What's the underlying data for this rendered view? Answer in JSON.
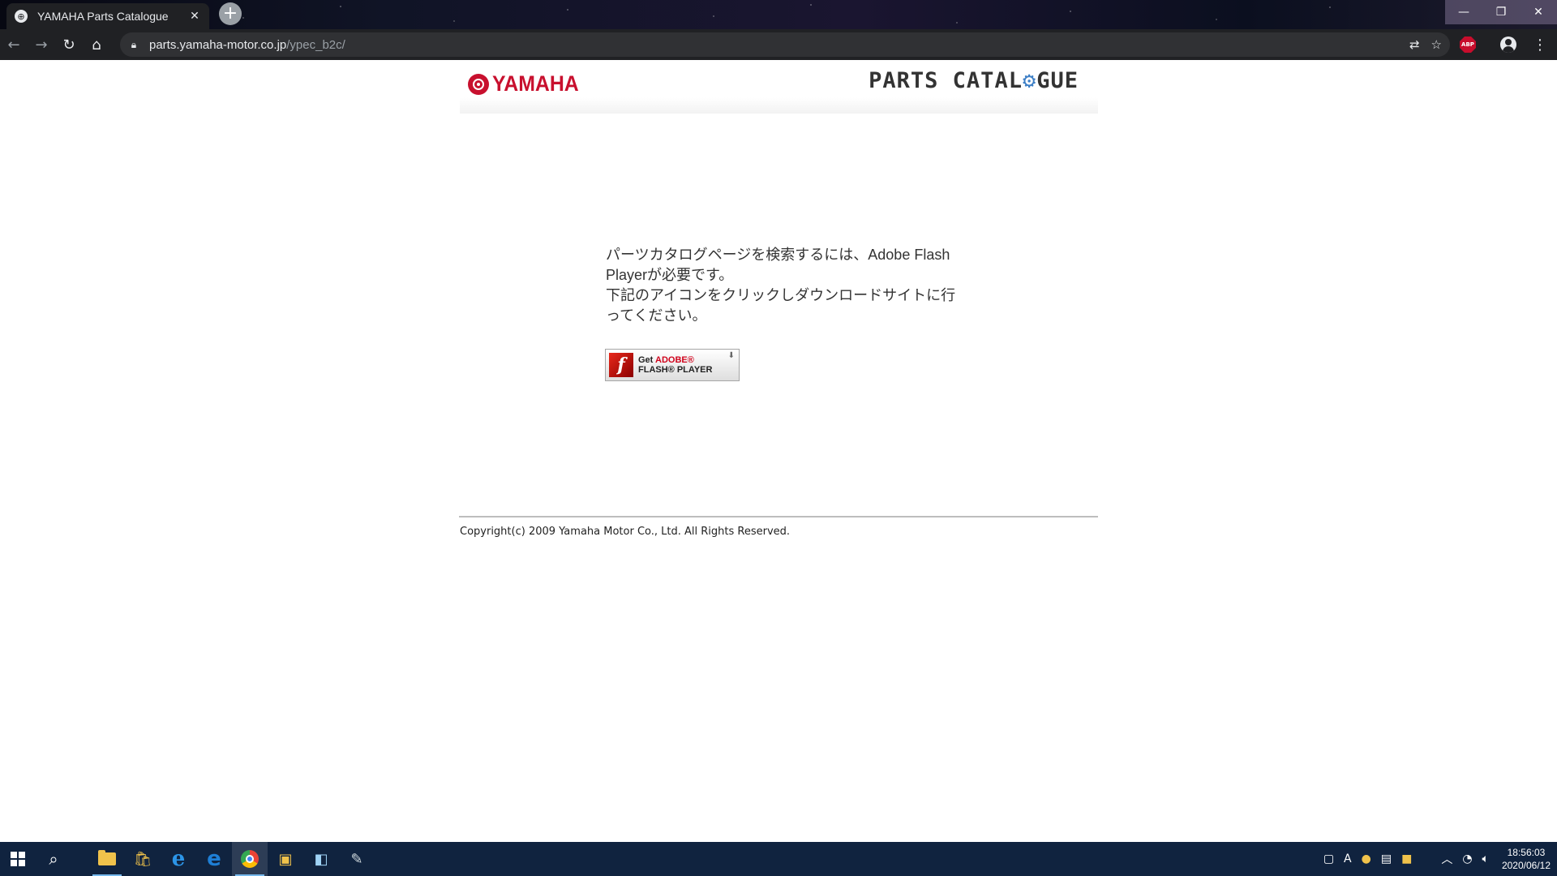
{
  "browser": {
    "tab_title": "YAMAHA Parts Catalogue",
    "tab_close_glyph": "✕",
    "new_tab_glyph": "+",
    "url_host": "parts.yamaha-motor.co.jp",
    "url_path": "/ypec_b2c/",
    "window_controls": {
      "minimize": "—",
      "restore": "❐",
      "close": "✕"
    },
    "icons": [
      "back-icon",
      "forward-icon",
      "reload-icon",
      "home-icon",
      "lock-icon",
      "translate-icon",
      "star-icon",
      "adblock-icon",
      "profile-icon",
      "menu-icon"
    ],
    "abp_label": "ABP"
  },
  "header": {
    "logo_text": "YAMAHA",
    "title_prefix": "PARTS CATAL",
    "title_gear": "⚙",
    "title_suffix": "GUE",
    "brand_color": "#c8102e"
  },
  "main": {
    "message_line1": "パーツカタログページを検索するには、Adobe Flash Playerが必要です。",
    "message_line2": "下記のアイコンをクリックしダウンロードサイトに行ってください。",
    "flash_button": {
      "logo_letter": "f",
      "line1_get": "Get ",
      "line1_adobe": "ADOBE®",
      "line2": "FLASH® PLAYER",
      "download_glyph": "⬇"
    }
  },
  "footer": {
    "copyright": "Copyright(c) 2009 Yamaha Motor Co., Ltd. All Rights Reserved."
  },
  "taskbar": {
    "time": "18:56:03",
    "date": "2020/06/12",
    "tray_ime": "A"
  }
}
